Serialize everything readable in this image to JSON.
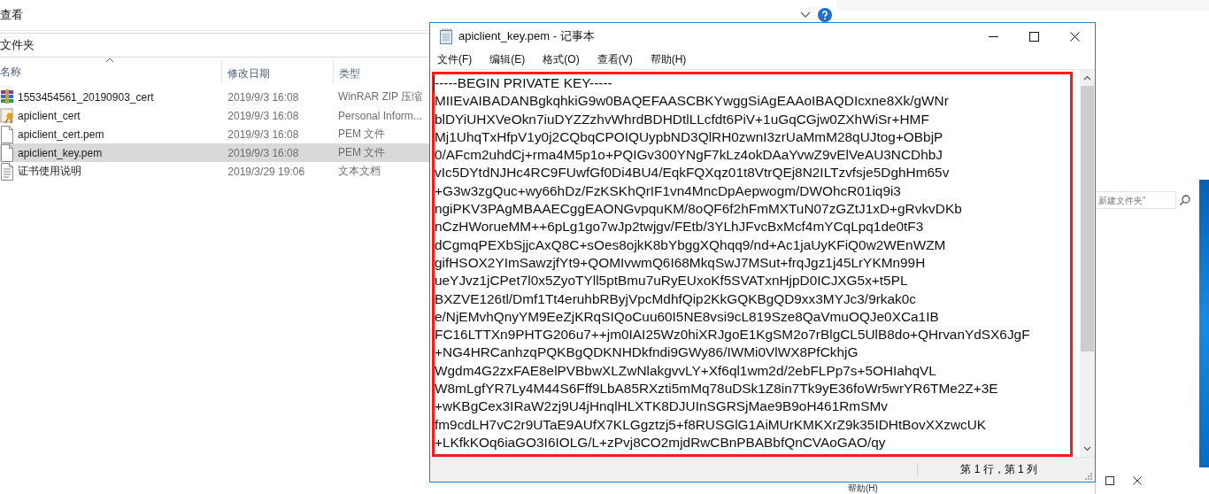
{
  "explorer": {
    "toolbar_label": "查看",
    "section_label": "文件夹",
    "columns": [
      "名称",
      "修改日期",
      "类型"
    ],
    "files": [
      {
        "kind": "archive",
        "name": "1553454561_20190903_cert",
        "modified": "2019/9/3 16:08",
        "type": "WinRAR ZIP 压缩",
        "selected": false
      },
      {
        "kind": "certificate",
        "name": "apiclient_cert",
        "modified": "2019/9/3 16:08",
        "type": "Personal Inform...",
        "selected": false
      },
      {
        "kind": "file",
        "name": "apiclient_cert.pem",
        "modified": "2019/9/3 16:08",
        "type": "PEM 文件",
        "selected": false
      },
      {
        "kind": "file",
        "name": "apiclient_key.pem",
        "modified": "2019/9/3 16:08",
        "type": "PEM 文件",
        "selected": true
      },
      {
        "kind": "text",
        "name": "证书使用说明",
        "modified": "2019/3/29 19:06",
        "type": "文本文档",
        "selected": false
      }
    ]
  },
  "background_window": {
    "search": {
      "placeholder": "新建文件夹”"
    },
    "menu_label": "帮助(H)"
  },
  "notepad": {
    "title": "apiclient_key.pem - 记事本",
    "menu": [
      "文件(F)",
      "编辑(E)",
      "格式(O)",
      "查看(V)",
      "帮助(H)"
    ],
    "lines": [
      "-----BEGIN PRIVATE KEY-----",
      "MIIEvAIBADANBgkqhkiG9w0BAQEFAASCBKYwggSiAgEAAoIBAQDIcxne8Xk/gWNr",
      "blDYiUHXVeOkn7iuDYZZzhvWhrdBDHDtlLLcfdt6PiV+1uGqCGjw0ZXhWiSr+HMF",
      "Mj1UhqTxHfpV1y0j2CQbqCPOIQUypbND3QlRH0zwnI3zrUaMmM28qUJtog+OBbjP",
      "0/AFcm2uhdCj+rma4M5p1o+PQIGv300YNgF7kLz4okDAaYvwZ9vElVeAU3NCDhbJ",
      "vIc5DYtdNJHc4RC9FUwfGf0Di4BU4/EqkFQXqz01t8VtrQEj8N2ILTzvfsje5DghHm65v",
      "+G3w3zgQuc+wy66hDz/FzKSKhQrIF1vn4MncDpAepwogm/DWOhcR01iq9i3",
      "ngiPKV3PAgMBAAECggEAONGvpquKM/8oQF6f2hFmMXTuN07zGZtJ1xD+gRvkvDKb",
      "nCzHWorueMM++6pLg1go7wJp2twjgv/FEtb/3YLhJFvcBxMcf4mYCqLpq1de0tF3",
      "dCgmqPEXbSjjcAxQ8C+sOes8ojkK8bYbggXQhqq9/nd+Ac1jaUyKFiQ0w2WEnWZM",
      "gifHSOX2YImSawzjfYt9+QOMIvwmQ6I68MkqSwJ7MSut+frqJgz1j45LrYKMn99H",
      "ueYJvz1jCPet7l0x5ZyoTYll5ptBmu7uRyEUxoKf5SVATxnHjpD0ICJXG5x+t5PL",
      "BXZVE126tl/Dmf1Tt4eruhbRByjVpcMdhfQip2KkGQKBgQD9xx3MYJc3/9rkak0c",
      "e/NjEMvhQnyYM9EeZjKRqSIQoCuu60I5NE8vsi9cL819Sze8QaVmuOQJe0XCa1IB",
      "FC16LTTXn9PHTG206u7++jm0IAI25Wz0hiXRJgoE1KgSM2o7rBlgCL5UlB8do+QHrvanYdSX6JgF",
      "+NG4HRCanhzqPQKBgQDKNHDkfndi9GWy86/IWMi0VlWX8PfCkhjG",
      "Wgdm4G2zxFAE8elPVBbwXLZwNlakgvvLY+Xf6ql1wm2d/2ebFLPp7s+5OHIahqVL",
      "W8mLgfYR7Ly4M44S6Fff9LbA85RXzti5mMq78uDSk1Z8in7Tk9yE36foWr5wrYR6TMe2Z+3E",
      "+wKBgCex3IRaW2zj9U4jHnqlHLXTK8DJUInSGRSjMae9B9oH461RmSMv",
      "fm9cdLH7vC2r9UTaE9AUfX7KLGgztzj5+f8RUSGlG1AiMUrKMKXrZ9k35IDHtBovXXzwcUK",
      "+LKfkKOq6iaGO3I6IOLG/L+zPvj8CO2mjdRwCBnPBABbfQnCVAoGAO/qy"
    ],
    "status": "第 1 行，第 1 列"
  }
}
